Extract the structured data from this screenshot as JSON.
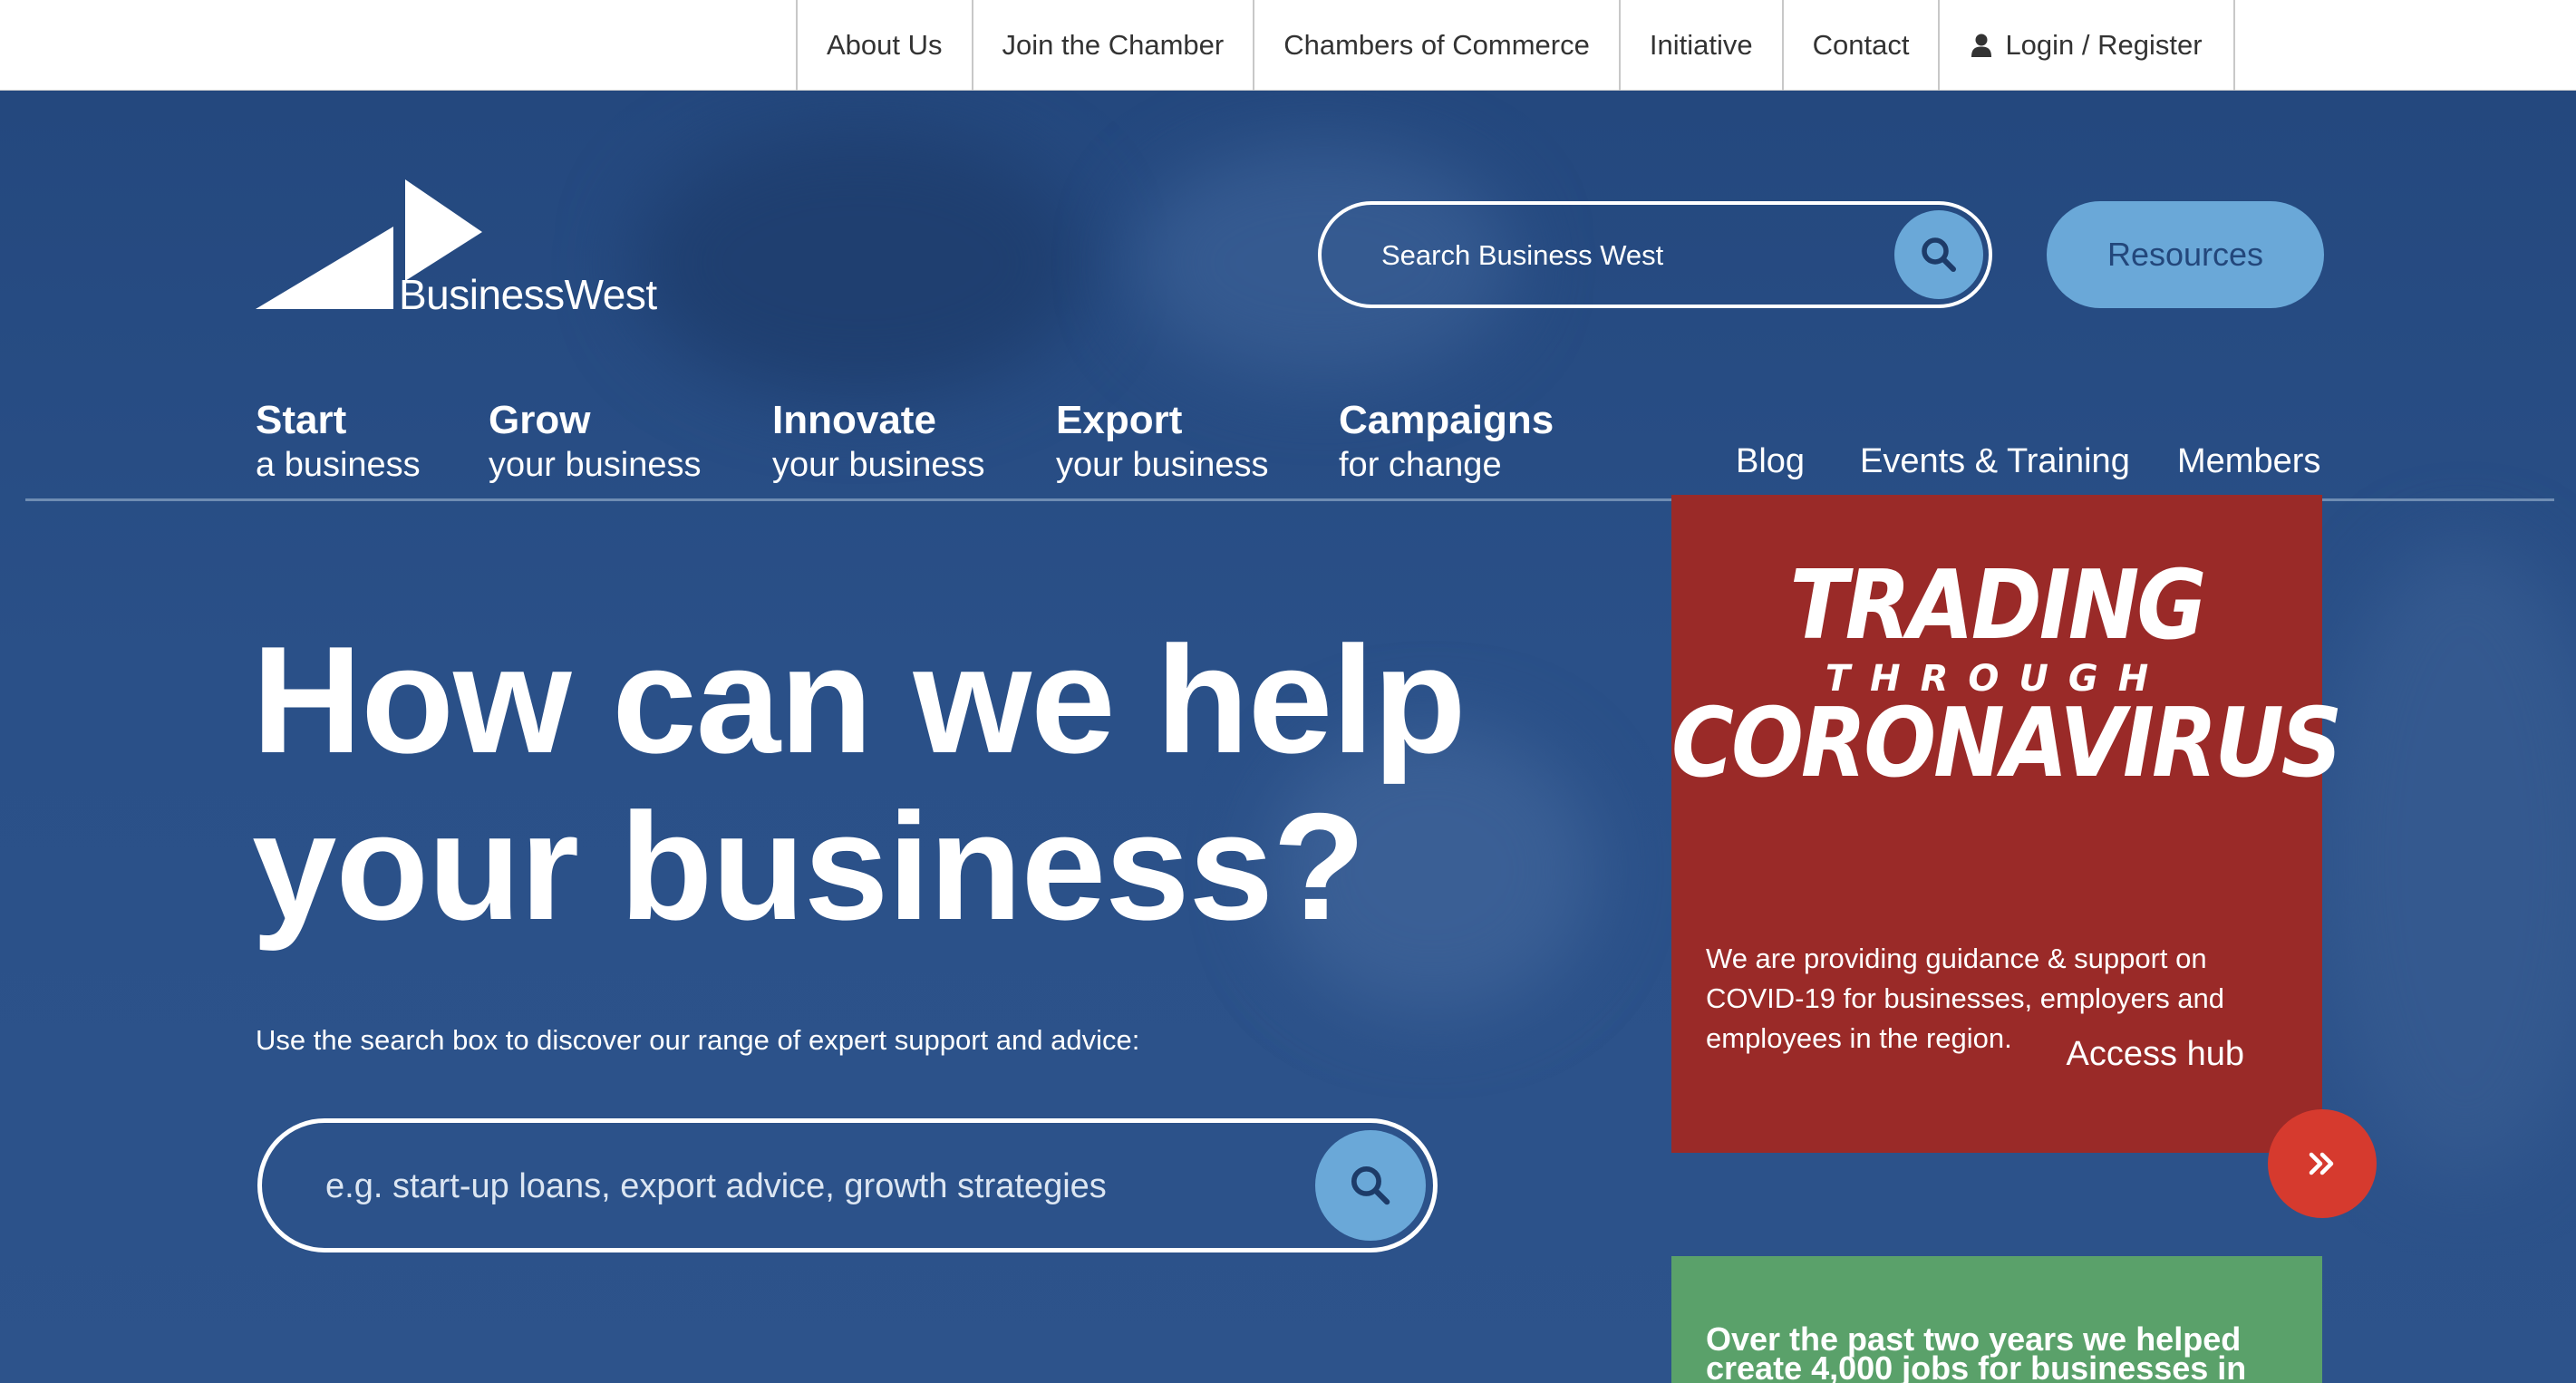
{
  "top_nav": {
    "items": [
      "About Us",
      "Join the Chamber",
      "Chambers of Commerce",
      "Initiative",
      "Contact"
    ],
    "login_label": "Login / Register"
  },
  "logo": {
    "text": "BusinessWest"
  },
  "header_search": {
    "placeholder": "Search Business West"
  },
  "resources_label": "Resources",
  "main_nav": [
    {
      "title": "Start",
      "sub": "a business"
    },
    {
      "title": "Grow",
      "sub": "your business"
    },
    {
      "title": "Innovate",
      "sub": "your business"
    },
    {
      "title": "Export",
      "sub": "your business"
    },
    {
      "title": "Campaigns",
      "sub": "for change"
    }
  ],
  "right_nav": [
    "Blog",
    "Events & Training",
    "Members"
  ],
  "hero": {
    "headline_line1": "How can we help",
    "headline_line2": "your business?",
    "subtext": "Use the search box to discover our range of expert support and advice:",
    "search_placeholder": "e.g. start-up loans, export advice, growth strategies"
  },
  "covid_card": {
    "title_top": "TRADING",
    "title_mid": "THROUGH",
    "title_bottom": "CORONAVIRUS",
    "description": "We are providing guidance & support on COVID-19 for businesses, employers and employees in the region.",
    "cta_label": "Access hub"
  },
  "green_card": {
    "text": "Over the past two years we helped create 4,000 jobs for businesses in"
  },
  "colors": {
    "hero_blue": "#2a5088",
    "accent_light_blue": "#6aa8d8",
    "covid_red": "#9a2a28",
    "cta_red": "#d63a2e",
    "green": "#5aa16a"
  }
}
